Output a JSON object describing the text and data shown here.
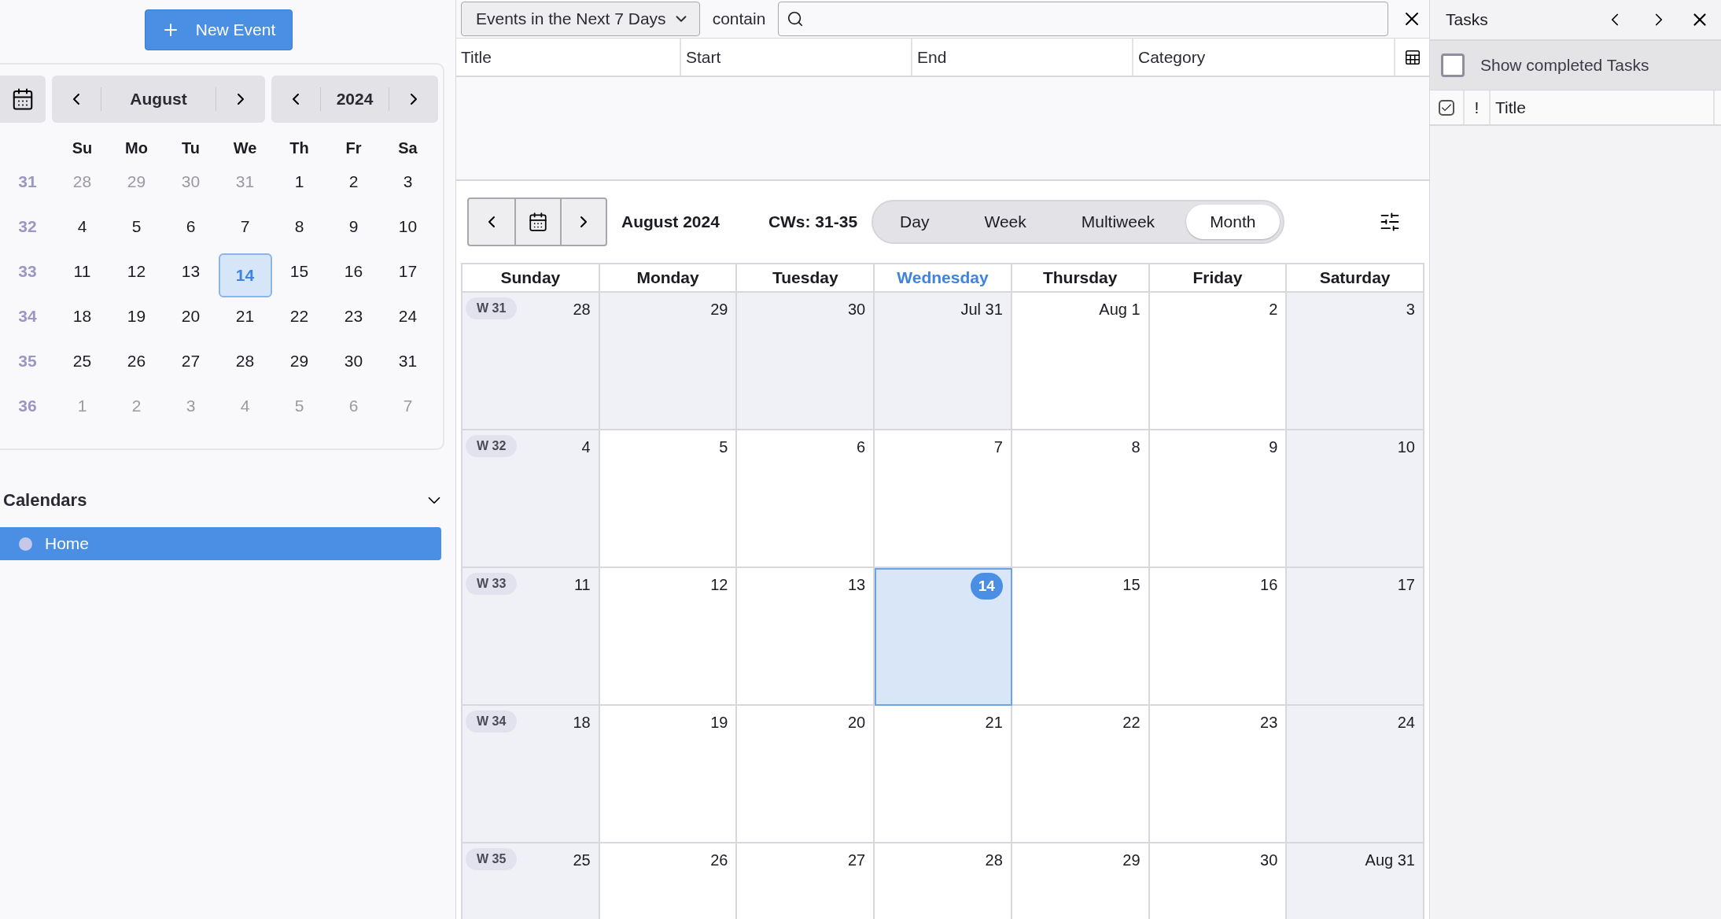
{
  "new_event_button": {
    "label": "New Event"
  },
  "mini_calendar": {
    "month": "August",
    "year": "2024",
    "weekdays": [
      "Su",
      "Mo",
      "Tu",
      "We",
      "Th",
      "Fr",
      "Sa"
    ],
    "weeks": [
      {
        "number": "31",
        "days": [
          {
            "label": "28",
            "other_month": true,
            "today": false
          },
          {
            "label": "29",
            "other_month": true,
            "today": false
          },
          {
            "label": "30",
            "other_month": true,
            "today": false
          },
          {
            "label": "31",
            "other_month": true,
            "today": false
          },
          {
            "label": "1",
            "other_month": false,
            "today": false
          },
          {
            "label": "2",
            "other_month": false,
            "today": false
          },
          {
            "label": "3",
            "other_month": false,
            "today": false
          }
        ]
      },
      {
        "number": "32",
        "days": [
          {
            "label": "4",
            "other_month": false,
            "today": false
          },
          {
            "label": "5",
            "other_month": false,
            "today": false
          },
          {
            "label": "6",
            "other_month": false,
            "today": false
          },
          {
            "label": "7",
            "other_month": false,
            "today": false
          },
          {
            "label": "8",
            "other_month": false,
            "today": false
          },
          {
            "label": "9",
            "other_month": false,
            "today": false
          },
          {
            "label": "10",
            "other_month": false,
            "today": false
          }
        ]
      },
      {
        "number": "33",
        "days": [
          {
            "label": "11",
            "other_month": false,
            "today": false
          },
          {
            "label": "12",
            "other_month": false,
            "today": false
          },
          {
            "label": "13",
            "other_month": false,
            "today": false
          },
          {
            "label": "14",
            "other_month": false,
            "today": true
          },
          {
            "label": "15",
            "other_month": false,
            "today": false
          },
          {
            "label": "16",
            "other_month": false,
            "today": false
          },
          {
            "label": "17",
            "other_month": false,
            "today": false
          }
        ]
      },
      {
        "number": "34",
        "days": [
          {
            "label": "18",
            "other_month": false,
            "today": false
          },
          {
            "label": "19",
            "other_month": false,
            "today": false
          },
          {
            "label": "20",
            "other_month": false,
            "today": false
          },
          {
            "label": "21",
            "other_month": false,
            "today": false
          },
          {
            "label": "22",
            "other_month": false,
            "today": false
          },
          {
            "label": "23",
            "other_month": false,
            "today": false
          },
          {
            "label": "24",
            "other_month": false,
            "today": false
          }
        ]
      },
      {
        "number": "35",
        "days": [
          {
            "label": "25",
            "other_month": false,
            "today": false
          },
          {
            "label": "26",
            "other_month": false,
            "today": false
          },
          {
            "label": "27",
            "other_month": false,
            "today": false
          },
          {
            "label": "28",
            "other_month": false,
            "today": false
          },
          {
            "label": "29",
            "other_month": false,
            "today": false
          },
          {
            "label": "30",
            "other_month": false,
            "today": false
          },
          {
            "label": "31",
            "other_month": false,
            "today": false
          }
        ]
      },
      {
        "number": "36",
        "days": [
          {
            "label": "1",
            "other_month": true,
            "today": false
          },
          {
            "label": "2",
            "other_month": true,
            "today": false
          },
          {
            "label": "3",
            "other_month": true,
            "today": false
          },
          {
            "label": "4",
            "other_month": true,
            "today": false
          },
          {
            "label": "5",
            "other_month": true,
            "today": false
          },
          {
            "label": "6",
            "other_month": true,
            "today": false
          },
          {
            "label": "7",
            "other_month": true,
            "today": false
          }
        ]
      }
    ]
  },
  "calendars": {
    "title": "Calendars",
    "expanded": true,
    "items": [
      {
        "name": "Home",
        "selected": true,
        "color": "#c5c8e6"
      }
    ]
  },
  "filter": {
    "dropdown": "Events in the Next 7 Days",
    "label": "contain"
  },
  "event_list": {
    "columns": [
      "Title",
      "Start",
      "End",
      "Category"
    ]
  },
  "toolbar": {
    "title": "August 2024",
    "week_range": "CWs: 31-35",
    "views": [
      {
        "label": "Day",
        "selected": false
      },
      {
        "label": "Week",
        "selected": false
      },
      {
        "label": "Multiweek",
        "selected": false
      },
      {
        "label": "Month",
        "selected": true
      }
    ]
  },
  "month_view": {
    "weekdays": [
      {
        "label": "Sunday",
        "today": false
      },
      {
        "label": "Monday",
        "today": false
      },
      {
        "label": "Tuesday",
        "today": false
      },
      {
        "label": "Wednesday",
        "today": true
      },
      {
        "label": "Thursday",
        "today": false
      },
      {
        "label": "Friday",
        "today": false
      },
      {
        "label": "Saturday",
        "today": false
      }
    ],
    "weeks": [
      {
        "badge": "W 31",
        "days": [
          {
            "label": "28",
            "shaded": true,
            "today": false
          },
          {
            "label": "29",
            "shaded": true,
            "today": false
          },
          {
            "label": "30",
            "shaded": true,
            "today": false
          },
          {
            "label": "Jul 31",
            "shaded": true,
            "today": false
          },
          {
            "label": "Aug 1",
            "shaded": false,
            "today": false
          },
          {
            "label": "2",
            "shaded": false,
            "today": false
          },
          {
            "label": "3",
            "shaded": true,
            "today": false
          }
        ]
      },
      {
        "badge": "W 32",
        "days": [
          {
            "label": "4",
            "shaded": true,
            "today": false
          },
          {
            "label": "5",
            "shaded": false,
            "today": false
          },
          {
            "label": "6",
            "shaded": false,
            "today": false
          },
          {
            "label": "7",
            "shaded": false,
            "today": false
          },
          {
            "label": "8",
            "shaded": false,
            "today": false
          },
          {
            "label": "9",
            "shaded": false,
            "today": false
          },
          {
            "label": "10",
            "shaded": true,
            "today": false
          }
        ]
      },
      {
        "badge": "W 33",
        "days": [
          {
            "label": "11",
            "shaded": true,
            "today": false
          },
          {
            "label": "12",
            "shaded": false,
            "today": false
          },
          {
            "label": "13",
            "shaded": false,
            "today": false
          },
          {
            "label": "14",
            "shaded": false,
            "today": true
          },
          {
            "label": "15",
            "shaded": false,
            "today": false
          },
          {
            "label": "16",
            "shaded": false,
            "today": false
          },
          {
            "label": "17",
            "shaded": true,
            "today": false
          }
        ]
      },
      {
        "badge": "W 34",
        "days": [
          {
            "label": "18",
            "shaded": true,
            "today": false
          },
          {
            "label": "19",
            "shaded": false,
            "today": false
          },
          {
            "label": "20",
            "shaded": false,
            "today": false
          },
          {
            "label": "21",
            "shaded": false,
            "today": false
          },
          {
            "label": "22",
            "shaded": false,
            "today": false
          },
          {
            "label": "23",
            "shaded": false,
            "today": false
          },
          {
            "label": "24",
            "shaded": true,
            "today": false
          }
        ]
      },
      {
        "badge": "W 35",
        "days": [
          {
            "label": "25",
            "shaded": true,
            "today": false
          },
          {
            "label": "26",
            "shaded": false,
            "today": false
          },
          {
            "label": "27",
            "shaded": false,
            "today": false
          },
          {
            "label": "28",
            "shaded": false,
            "today": false
          },
          {
            "label": "29",
            "shaded": false,
            "today": false
          },
          {
            "label": "30",
            "shaded": false,
            "today": false
          },
          {
            "label": "Aug 31",
            "shaded": true,
            "today": false
          }
        ]
      }
    ]
  },
  "tasks": {
    "title": "Tasks",
    "show_completed": {
      "label": "Show completed Tasks",
      "checked": false
    },
    "columns": [
      "!",
      "Title"
    ]
  }
}
